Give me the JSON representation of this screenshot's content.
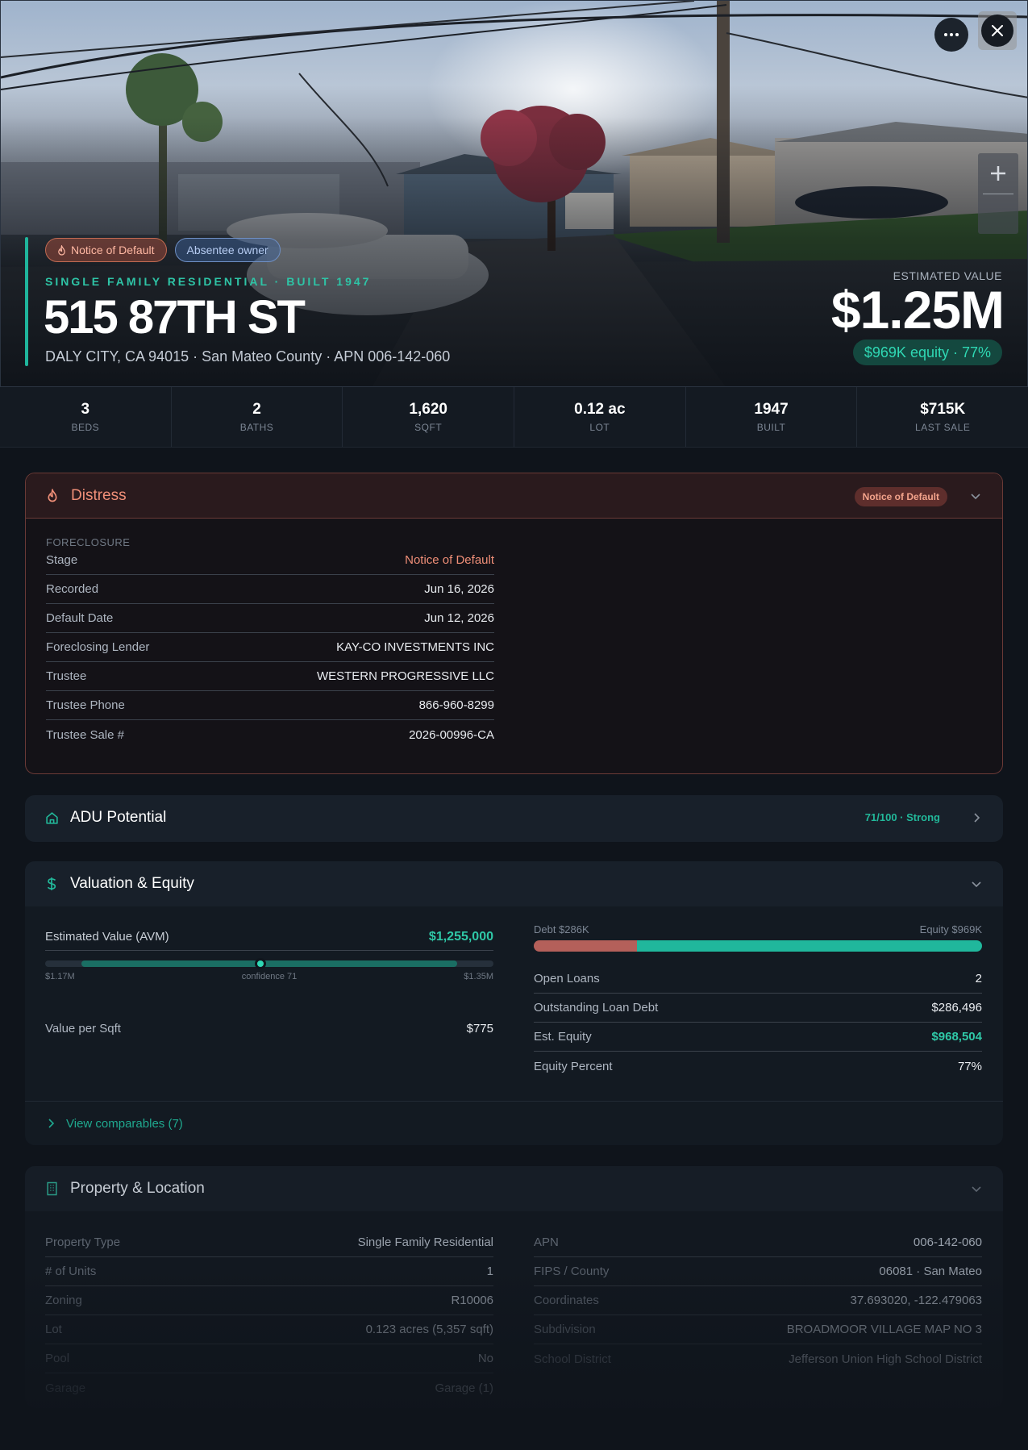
{
  "hero": {
    "tags": {
      "notice_of_default": "Notice of Default",
      "absentee_owner": "Absentee owner"
    },
    "eyebrow": "SINGLE FAMILY RESIDENTIAL · BUILT 1947",
    "address": "515 87TH ST",
    "subaddress": "DALY CITY, CA 94015 · San Mateo County · APN 006-142-060",
    "estimated_value_label": "ESTIMATED VALUE",
    "estimated_value": "$1.25M",
    "equity_pill": "$969K equity · 77%",
    "more_icon": "more-horizontal-icon",
    "close_icon": "close-icon",
    "zoom_icon": "plus-icon"
  },
  "stats": [
    {
      "value": "3",
      "label": "BEDS"
    },
    {
      "value": "2",
      "label": "BATHS"
    },
    {
      "value": "1,620",
      "label": "SQFT"
    },
    {
      "value": "0.12 ac",
      "label": "LOT"
    },
    {
      "value": "1947",
      "label": "BUILT"
    },
    {
      "value": "$715K",
      "label": "LAST SALE"
    }
  ],
  "distress": {
    "title": "Distress",
    "badge": "Notice of Default",
    "section": "FORECLOSURE",
    "rows": [
      {
        "key": "Stage",
        "value": "Notice of Default"
      },
      {
        "key": "Recorded",
        "value": "Jun 16, 2026"
      },
      {
        "key": "Default Date",
        "value": "Jun 12, 2026"
      },
      {
        "key": "Foreclosing Lender",
        "value": "KAY-CO INVESTMENTS INC"
      },
      {
        "key": "Trustee",
        "value": "WESTERN PROGRESSIVE LLC"
      },
      {
        "key": "Trustee Phone",
        "value": "866-960-8299"
      },
      {
        "key": "Trustee Sale #",
        "value": "2026-00996-CA"
      }
    ],
    "accent_color": "#f08f78"
  },
  "adu": {
    "title": "ADU Potential",
    "score": "71/100 · Strong"
  },
  "valuation": {
    "title": "Valuation & Equity",
    "avm_label": "Estimated Value (AVM)",
    "avm_value": "$1,255,000",
    "range_low": "$1.17M",
    "range_mid": "confidence 71",
    "range_high": "$1.35M",
    "avm_position_fraction": 0.48,
    "value_per_sqft_label": "Value per Sqft",
    "value_per_sqft": "$775",
    "debt_label": "Debt $286K",
    "equity_label": "Equity $969K",
    "debt_fraction": 0.23,
    "rows": [
      {
        "key": "Open Loans",
        "value": "2"
      },
      {
        "key": "Outstanding Loan Debt",
        "value": "$286,496"
      },
      {
        "key": "Est. Equity",
        "value": "$968,504"
      },
      {
        "key": "Equity Percent",
        "value": "77%"
      }
    ],
    "comparables_link": "View comparables (7)",
    "accent_color": "#2fc8a7"
  },
  "property": {
    "title": "Property & Location",
    "left_rows": [
      {
        "key": "Property Type",
        "value": "Single Family Residential"
      },
      {
        "key": "# of Units",
        "value": "1"
      },
      {
        "key": "Zoning",
        "value": "R10006"
      },
      {
        "key": "Lot",
        "value": "0.123 acres (5,357 sqft)"
      },
      {
        "key": "Pool",
        "value": "No"
      },
      {
        "key": "Garage",
        "value": "Garage (1)"
      }
    ],
    "right_rows": [
      {
        "key": "APN",
        "value": "006-142-060"
      },
      {
        "key": "FIPS / County",
        "value": "06081 · San Mateo"
      },
      {
        "key": "Coordinates",
        "value": "37.693020, -122.479063"
      },
      {
        "key": "Subdivision",
        "value": "BROADMOOR VILLAGE MAP NO 3"
      },
      {
        "key": "School District",
        "value": "Jefferson Union High School District"
      }
    ]
  }
}
